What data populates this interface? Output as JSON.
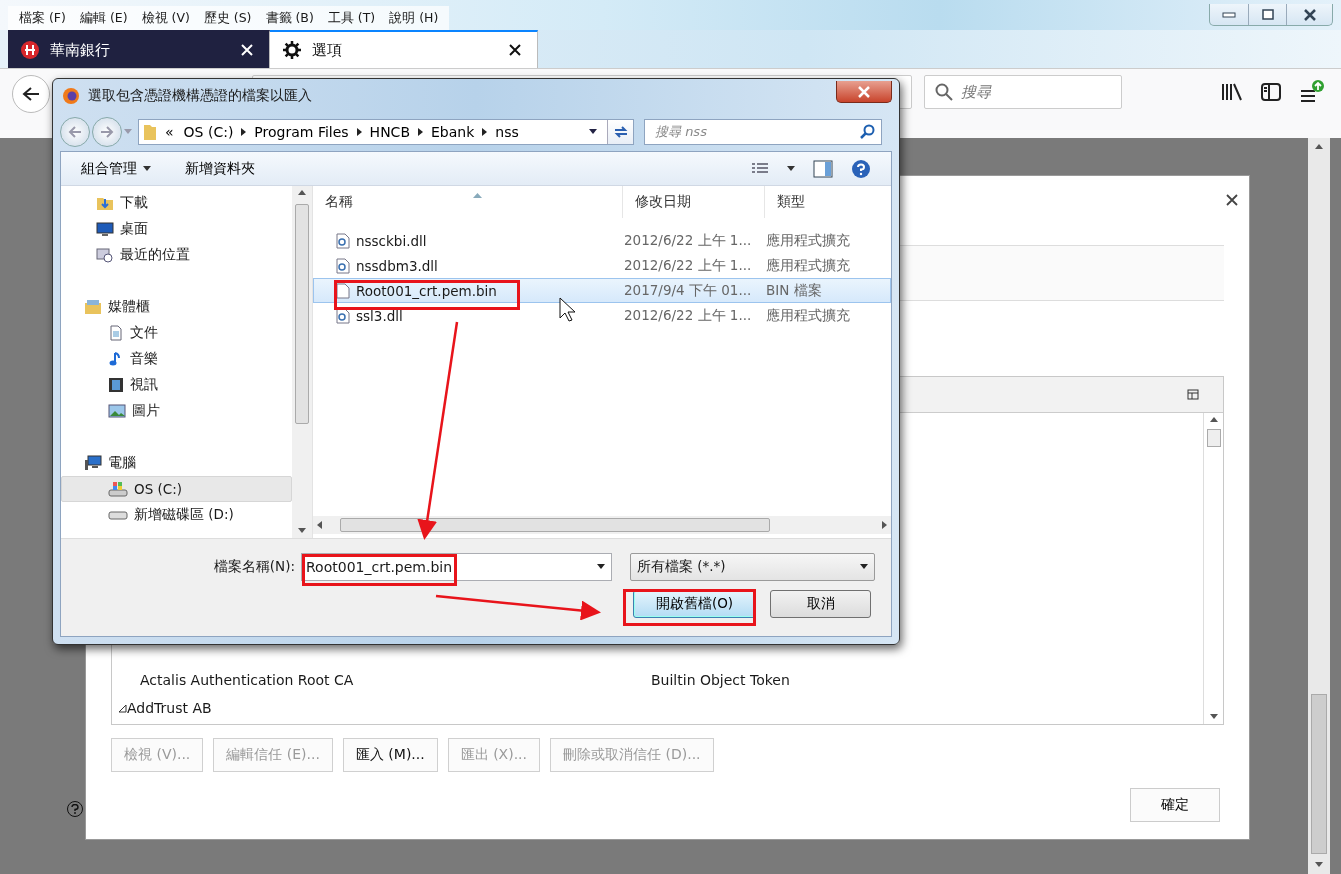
{
  "menu_bar": [
    "檔案 (F)",
    "編輯 (E)",
    "檢視 (V)",
    "歷史 (S)",
    "書籤 (B)",
    "工具 (T)",
    "說明 (H)"
  ],
  "tabs": [
    {
      "label": "華南銀行",
      "selected": false
    },
    {
      "label": "選項",
      "selected": true
    }
  ],
  "search": {
    "placeholder": "搜尋"
  },
  "cert_manager": {
    "rows": [
      {
        "kind": "cert",
        "label": "Actalis Authentication Root CA",
        "token": "Builtin Object Token"
      },
      {
        "kind": "group",
        "label": "AddTrust AB",
        "expanded": true
      }
    ],
    "buttons": [
      {
        "label": "檢視 (V)...",
        "disabled": true
      },
      {
        "label": "編輯信任 (E)...",
        "disabled": true
      },
      {
        "label": "匯入 (M)...",
        "disabled": false
      },
      {
        "label": "匯出 (X)...",
        "disabled": true
      },
      {
        "label": "刪除或取消信任 (D)...",
        "disabled": true
      }
    ],
    "ok_button": "確定"
  },
  "file_dialog": {
    "title": "選取包含憑證機構憑證的檔案以匯入",
    "path_overflow": "«",
    "path": [
      "OS (C:)",
      "Program Files",
      "HNCB",
      "Ebank",
      "nss"
    ],
    "search": {
      "placeholder": "搜尋 nss"
    },
    "organize": "組合管理",
    "new_folder": "新增資料夾",
    "nav_tree": [
      {
        "kind": "download",
        "label": "下載",
        "selected": false
      },
      {
        "kind": "desktop",
        "label": "桌面",
        "selected": false
      },
      {
        "kind": "recent",
        "label": "最近的位置",
        "selected": false
      },
      {
        "kind": "library",
        "label": "媒體櫃",
        "selected": false,
        "children": [
          {
            "kind": "document",
            "label": "文件",
            "selected": false
          },
          {
            "kind": "music",
            "label": "音樂",
            "selected": false
          },
          {
            "kind": "video",
            "label": "視訊",
            "selected": false
          },
          {
            "kind": "picture",
            "label": "圖片",
            "selected": false
          }
        ]
      },
      {
        "kind": "computer",
        "label": "電腦",
        "selected": false,
        "children": [
          {
            "kind": "system-drive",
            "label": "OS (C:)",
            "selected": true
          },
          {
            "kind": "drive",
            "label": "新增磁碟區 (D:)",
            "selected": false
          }
        ]
      }
    ],
    "columns": [
      "名稱",
      "修改日期",
      "類型"
    ],
    "files": [
      {
        "kind": "dll",
        "name": "nssckbi.dll",
        "date": "2012/6/22 上午 1...",
        "type": "應用程式擴充",
        "selected": false
      },
      {
        "kind": "dll",
        "name": "nssdbm3.dll",
        "date": "2012/6/22 上午 1...",
        "type": "應用程式擴充",
        "selected": false
      },
      {
        "kind": "file",
        "name": "Root001_crt.pem.bin",
        "date": "2017/9/4 下午 01...",
        "type": "BIN 檔案",
        "selected": true
      },
      {
        "kind": "dll",
        "name": "ssl3.dll",
        "date": "2012/6/22 上午 1...",
        "type": "應用程式擴充",
        "selected": false
      }
    ],
    "filename_label": "檔案名稱(N):",
    "filename": "Root001_crt.pem.bin",
    "filter": "所有檔案 (*.*)",
    "open_button": "開啟舊檔(O)",
    "cancel_button": "取消"
  }
}
